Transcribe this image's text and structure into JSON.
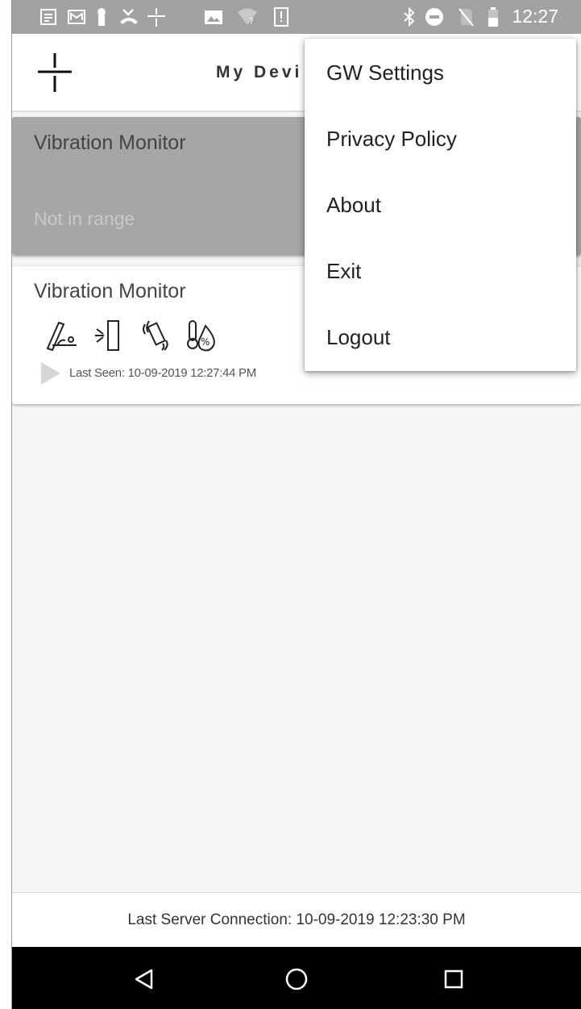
{
  "status_bar": {
    "time": "12:27",
    "left_icons": [
      "notes-icon",
      "mail-icon",
      "keyhole-icon",
      "missed-call-icon",
      "app-logo-icon",
      "image-icon",
      "wifi-unknown-icon",
      "sim-alert-icon"
    ],
    "right_icons": [
      "bluetooth-icon",
      "do-not-disturb-icon",
      "no-sim-icon",
      "battery-icon"
    ]
  },
  "app_bar": {
    "title": "My Devi",
    "logo": "app-logo-icon"
  },
  "devices": [
    {
      "name": "Vibration Monitor",
      "status": "Not in range",
      "in_range": false
    },
    {
      "name": "Vibration Monitor",
      "in_range": true,
      "sensors": [
        "tilt-sensor-icon",
        "proximity-sensor-icon",
        "vibration-sensor-icon",
        "temperature-humidity-icon"
      ],
      "last_seen": "Last Seen: 10-09-2019 12:27:44 PM"
    }
  ],
  "menu": {
    "items": [
      "GW Settings",
      "Privacy Policy",
      "About",
      "Exit",
      "Logout"
    ]
  },
  "footer": {
    "last_connection": "Last Server Connection: 10-09-2019 12:23:30 PM"
  },
  "nav_bar": {
    "buttons": [
      "back-icon",
      "home-icon",
      "recents-icon"
    ]
  },
  "colors": {
    "status_bar": "#a2a2a2",
    "background": "#f5f5f5",
    "out_of_range_card": "#a6a6a6",
    "menu": "#ffffff"
  }
}
